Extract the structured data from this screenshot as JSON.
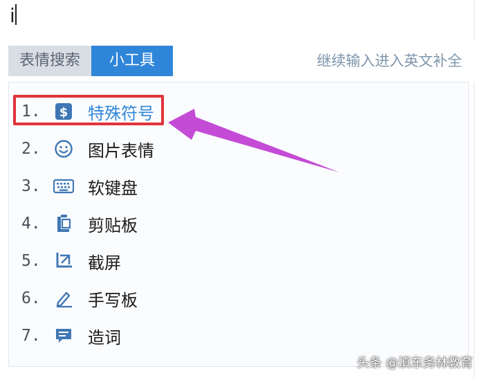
{
  "input": {
    "value": "i"
  },
  "toolbar": {
    "tab_emoji_search": "表情搜索",
    "tab_tools": "小工具",
    "hint": "继续输入进入英文补全"
  },
  "menu": {
    "items": [
      {
        "num": "1.",
        "label": "特殊符号",
        "icon": "dollar-sign-icon"
      },
      {
        "num": "2.",
        "label": "图片表情",
        "icon": "smiley-face-icon"
      },
      {
        "num": "3.",
        "label": "软键盘",
        "icon": "keyboard-icon"
      },
      {
        "num": "4.",
        "label": "剪贴板",
        "icon": "clipboard-icon"
      },
      {
        "num": "5.",
        "label": "截屏",
        "icon": "crop-icon"
      },
      {
        "num": "6.",
        "label": "手写板",
        "icon": "pen-icon"
      },
      {
        "num": "7.",
        "label": "造词",
        "icon": "chat-bubble-icon"
      }
    ]
  },
  "colors": {
    "accent": "#2f86d8",
    "highlight": "#e0333b",
    "arrow": "#c44bd6"
  },
  "watermark": "头条 @滇东务林教育"
}
